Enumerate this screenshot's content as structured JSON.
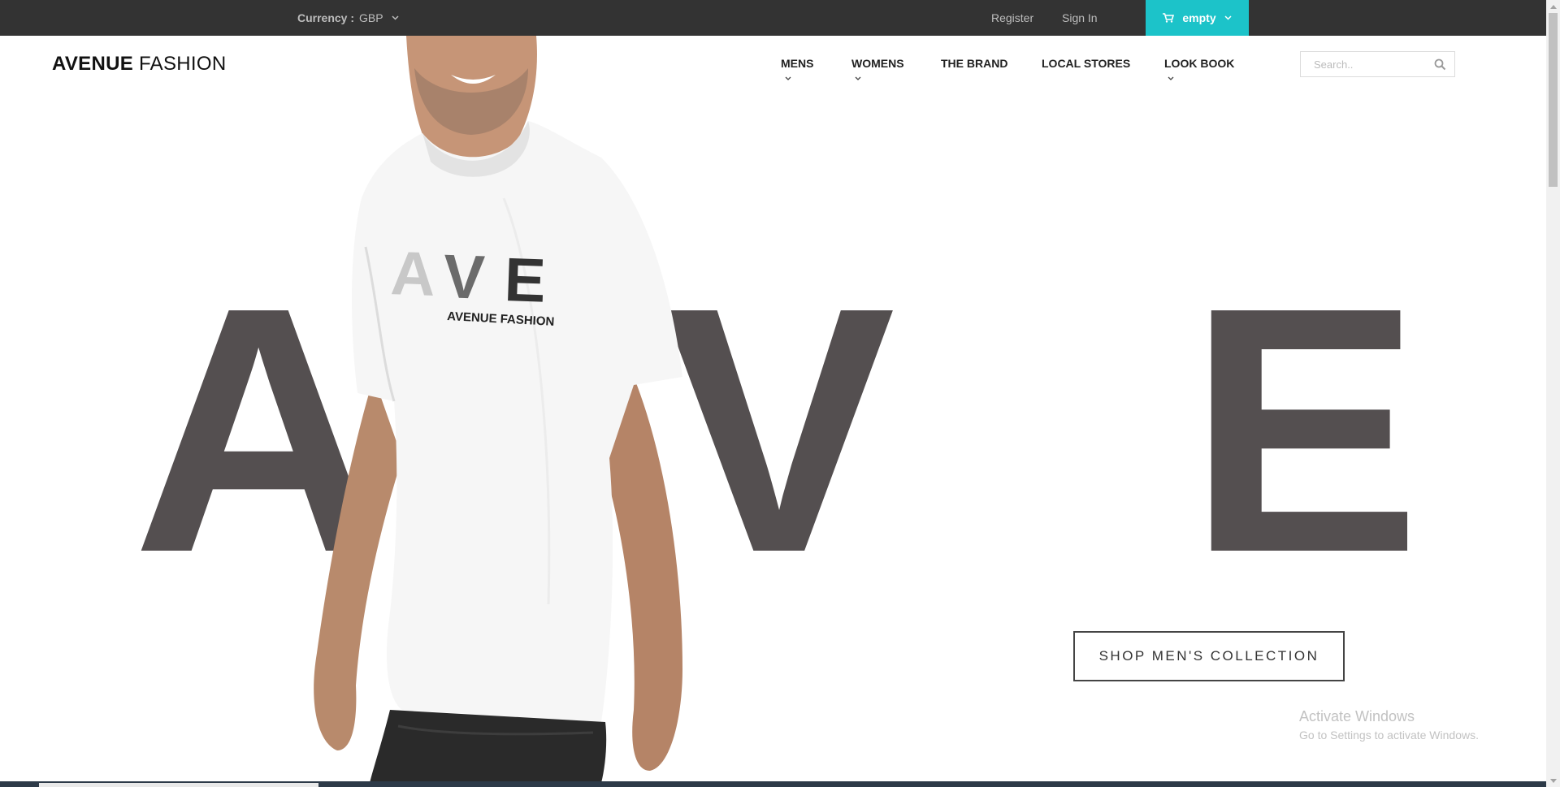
{
  "topbar": {
    "currency_label": "Currency :",
    "currency_value": "GBP",
    "register": "Register",
    "signin": "Sign In",
    "cart_label": "empty",
    "cart_color": "#1cc3c9"
  },
  "header": {
    "logo_bold": "AVENUE",
    "logo_light": "FASHION",
    "nav": [
      {
        "label": "MENS"
      },
      {
        "label": "WOMENS"
      },
      {
        "label": "THE BRAND"
      },
      {
        "label": "LOCAL STORES"
      },
      {
        "label": "LOOK BOOK"
      }
    ],
    "search_placeholder": "Search.."
  },
  "hero": {
    "letters": [
      "A",
      "V",
      "E"
    ],
    "shirt_letters": "AVE",
    "shirt_brand": "AVENUE FASHION",
    "cta": "SHOP MEN'S COLLECTION",
    "letter_color": "#544f50"
  },
  "watermark": {
    "title": "Activate Windows",
    "subtitle": "Go to Settings to activate Windows."
  },
  "icons": [
    "cart-icon",
    "chevron-down-icon",
    "search-icon"
  ]
}
